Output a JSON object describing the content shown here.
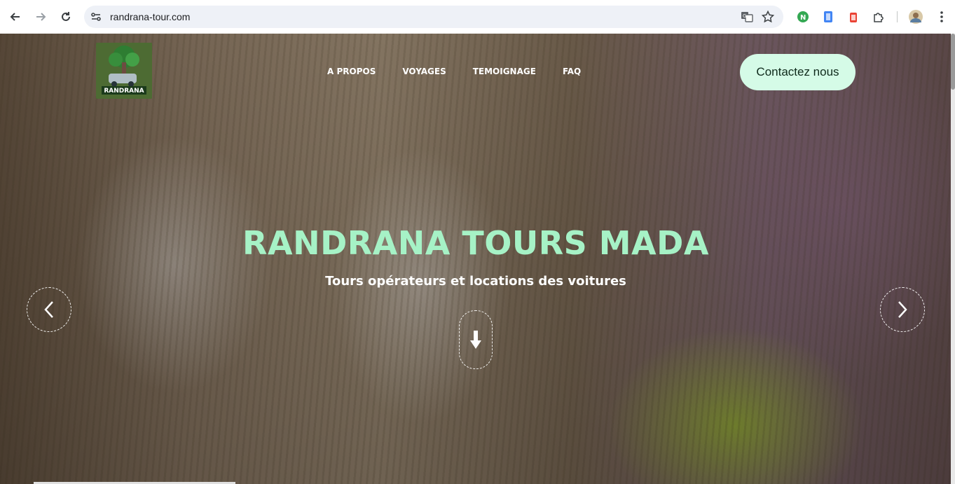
{
  "browser": {
    "url": "randrana-tour.com",
    "icons": [
      "back-icon",
      "forward-icon",
      "reload-icon",
      "site-info-icon",
      "translate-icon",
      "star-icon",
      "extension-green-icon",
      "extension-blue-icon",
      "extension-red-icon",
      "extensions-puzzle-icon",
      "profile-avatar",
      "more-menu-icon"
    ]
  },
  "site": {
    "logo_text": "RANDRANA",
    "nav": {
      "apropos": "A PROPOS",
      "voyages": "VOYAGES",
      "temoignage": "TEMOIGNAGE",
      "faq": "FAQ"
    },
    "contact_label": "Contactez nous",
    "hero": {
      "title": "RANDRANA TOURS MADA",
      "subtitle": "Tours opérateurs et locations des voitures"
    }
  },
  "colors": {
    "accent_mint": "#a6f2c6",
    "button_bg": "#d5fbe7"
  }
}
